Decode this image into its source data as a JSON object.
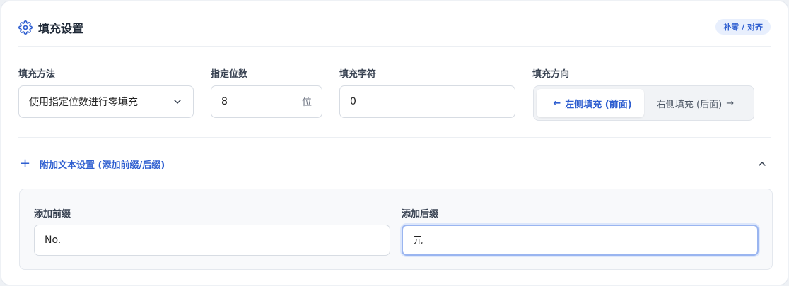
{
  "header": {
    "title": "填充设置",
    "badge": "补零 / 对齐",
    "icon": "gear-icon"
  },
  "fields": {
    "method": {
      "label": "填充方法",
      "value": "使用指定位数进行零填充"
    },
    "digits": {
      "label": "指定位数",
      "value": "8",
      "unit": "位"
    },
    "char": {
      "label": "填充字符",
      "value": "0"
    },
    "direction": {
      "label": "填充方向",
      "options": [
        {
          "label": "左侧填充 (前面)",
          "arrow": "←",
          "selected": true
        },
        {
          "label": "右侧填充 (后面)",
          "arrow": "→",
          "selected": false
        }
      ]
    }
  },
  "extra": {
    "toggle_label": "附加文本设置 (添加前缀/后缀)",
    "expanded": true,
    "prefix": {
      "label": "添加前缀",
      "value": "No."
    },
    "suffix": {
      "label": "添加后缀",
      "value": "元"
    }
  },
  "colors": {
    "accent": "#2f5fd0",
    "badge_bg": "#e8effd",
    "focus_border": "#9ab5f0"
  }
}
